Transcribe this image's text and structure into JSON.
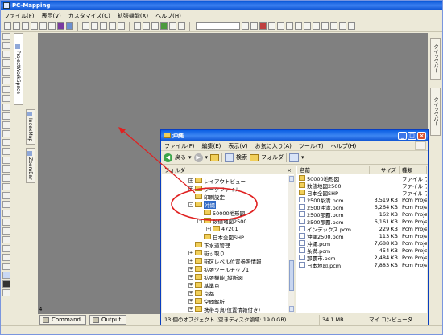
{
  "app": {
    "title": "PC-Mapping",
    "menu": [
      "ファイル(F)",
      "表示(V)",
      "カスタマイズ(C)",
      "拡張機能(X)",
      "ヘルプ(H)"
    ],
    "side_tabs": [
      "ProjectWorkSpace",
      "IndexMap",
      "ZoomBar"
    ],
    "right_tabs": [
      "クイックバー",
      "クイックバー"
    ],
    "page_number": "4",
    "bottom_tabs": [
      "Command",
      "Output"
    ]
  },
  "explorer": {
    "title": "沖縄",
    "menu": [
      "ファイル(F)",
      "編集(E)",
      "表示(V)",
      "お気に入り(A)",
      "ツール(T)",
      "ヘルプ(H)"
    ],
    "toolbar": {
      "back": "戻る",
      "search": "検索",
      "folders": "フォルダ"
    },
    "folder_pane_title": "フォルダ",
    "tree": [
      {
        "label": "レイアウトビュー",
        "indent": 3,
        "expander": "+",
        "selected": false
      },
      {
        "label": "ワークファイル",
        "indent": 3,
        "expander": "+",
        "selected": false
      },
      {
        "label": "印刷設定",
        "indent": 3,
        "expander": "",
        "selected": false
      },
      {
        "label": "沖縄",
        "indent": 3,
        "expander": "-",
        "selected": true
      },
      {
        "label": "50000地形図",
        "indent": 4,
        "expander": "",
        "selected": false
      },
      {
        "label": "数値地図2500",
        "indent": 4,
        "expander": "-",
        "selected": false
      },
      {
        "label": "47201",
        "indent": 5,
        "expander": "+",
        "selected": false
      },
      {
        "label": "日本全図SHP",
        "indent": 4,
        "expander": "",
        "selected": false
      },
      {
        "label": "下水道管理",
        "indent": 3,
        "expander": "",
        "selected": false
      },
      {
        "label": "街ッ取り",
        "indent": 3,
        "expander": "+",
        "selected": false
      },
      {
        "label": "街区レベル位置参照情報",
        "indent": 3,
        "expander": "+",
        "selected": false
      },
      {
        "label": "拡張ツールチップ1",
        "indent": 3,
        "expander": "+",
        "selected": false
      },
      {
        "label": "拡張機能_縦断図",
        "indent": 3,
        "expander": "+",
        "selected": false
      },
      {
        "label": "基準点",
        "indent": 3,
        "expander": "+",
        "selected": false
      },
      {
        "label": "京都",
        "indent": 3,
        "expander": "+",
        "selected": false
      },
      {
        "label": "空間解析",
        "indent": 3,
        "expander": "+",
        "selected": false
      },
      {
        "label": "携帯写真(位置情報付き)",
        "indent": 3,
        "expander": "+",
        "selected": false
      }
    ],
    "columns": [
      "名前",
      "サイズ",
      "種類"
    ],
    "files": [
      {
        "name": "50000地形図",
        "size": "",
        "type": "ファイル フ",
        "folder": true
      },
      {
        "name": "数値地図2500",
        "size": "",
        "type": "ファイル フ",
        "folder": true
      },
      {
        "name": "日本全図SHP",
        "size": "",
        "type": "ファイル フ",
        "folder": true
      },
      {
        "name": "2500糸満.pcm",
        "size": "3,519 KB",
        "type": "Pcm Proje",
        "folder": false
      },
      {
        "name": "2500沖満.pcm",
        "size": "6,264 KB",
        "type": "Pcm Proje",
        "folder": false
      },
      {
        "name": "2500那覇.pcm",
        "size": "162 KB",
        "type": "Pcm Proje",
        "folder": false
      },
      {
        "name": "2500那覇.pcm",
        "size": "6,161 KB",
        "type": "Pcm Proje",
        "folder": false
      },
      {
        "name": "インデックス.pcm",
        "size": "229 KB",
        "type": "Pcm Proje",
        "folder": false
      },
      {
        "name": "沖縄2500.pcm",
        "size": "113 KB",
        "type": "Pcm Proje",
        "folder": false
      },
      {
        "name": "沖縄.pcm",
        "size": "7,688 KB",
        "type": "Pcm Proje",
        "folder": false
      },
      {
        "name": "糸満.pcm",
        "size": "454 KB",
        "type": "Pcm Proje",
        "folder": false
      },
      {
        "name": "那覇市.pcm",
        "size": "2,484 KB",
        "type": "Pcm Proje",
        "folder": false
      },
      {
        "name": "日本地図.pcm",
        "size": "7,883 KB",
        "type": "Pcm Proje",
        "folder": false
      }
    ],
    "status": [
      "13 個のオブジェクト (空きディスク領域: 19.0 GB)",
      "34.1 MB",
      "マイ コンピュータ"
    ]
  },
  "annotation": {
    "color": "#e02020"
  }
}
